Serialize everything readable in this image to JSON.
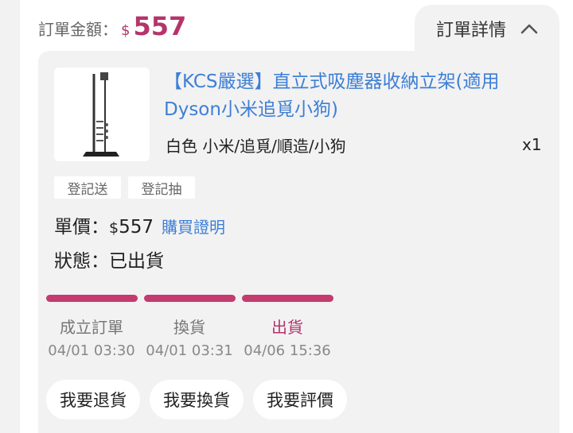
{
  "order": {
    "amount_label": "訂單金額：",
    "currency": "$",
    "amount": "557"
  },
  "detail_tab": {
    "label": "訂單詳情",
    "icon": "chevron-up-icon"
  },
  "product": {
    "image_icon": "vacuum-stand-image",
    "title": "【KCS嚴選】直立式吸塵器收納立架(適用Dyson小米追覓小狗)",
    "variant": "白色 小米/追覓/順造/小狗",
    "quantity": "x1"
  },
  "tags": [
    "登記送",
    "登記抽"
  ],
  "price": {
    "label": "單價：",
    "currency": "$",
    "value": "557",
    "proof_link": "購買證明"
  },
  "status": {
    "label": "狀態：",
    "value": "已出貨"
  },
  "progress": {
    "color": "#c43b70",
    "steps": [
      {
        "name": "成立訂單",
        "time": "04/01 03:30",
        "done": true
      },
      {
        "name": "換貨",
        "time": "04/01 03:31",
        "done": true
      },
      {
        "name": "出貨",
        "time": "04/06 15:36",
        "done": true,
        "current": true
      }
    ]
  },
  "actions": [
    "我要退貨",
    "我要換貨",
    "我要評價"
  ],
  "colors": {
    "accent": "#b5346b",
    "link": "#3d7fd6"
  }
}
